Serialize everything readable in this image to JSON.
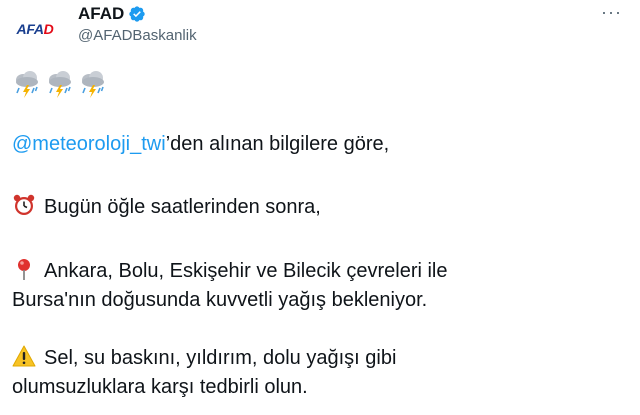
{
  "account": {
    "avatar_text_a": "AFA",
    "avatar_text_b": "D",
    "display_name": "AFAD",
    "handle": "@AFADBaskanlik",
    "verified": true,
    "brand_blue": "#1a3f8f",
    "brand_red": "#e30a17"
  },
  "menu": {
    "more_label": "···"
  },
  "tweet": {
    "weather_icons": [
      "storm-cloud-icon",
      "storm-cloud-icon",
      "storm-cloud-icon"
    ],
    "mention": "@meteoroloji_twi",
    "line1_rest": "’den alınan bilgilere göre,",
    "line2": "Bugün öğle saatlerinden sonra,",
    "line3a": "Ankara, Bolu, Eskişehir ve Bilecik çevreleri ile",
    "line3b": "Bursa'nın doğusunda kuvvetli yağış bekleniyor.",
    "line4a": "Sel, su baskını, yıldırım, dolu yağışı gibi",
    "line4b": "olumsuzluklara karşı tedbirli olun.",
    "mention_color": "#1d9bf0"
  }
}
